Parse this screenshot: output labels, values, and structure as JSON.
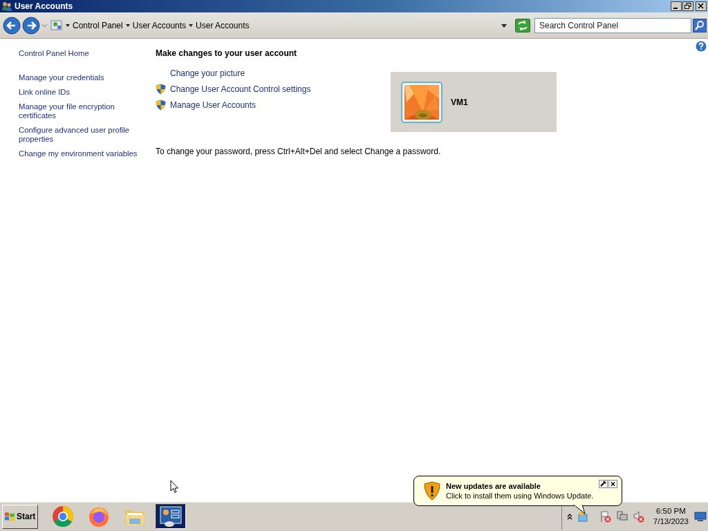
{
  "window": {
    "title": "User Accounts"
  },
  "address_bar": {
    "breadcrumb": [
      "Control Panel",
      "User Accounts",
      "User Accounts"
    ],
    "search": {
      "placeholder": "Search Control Panel"
    }
  },
  "sidebar": {
    "home": "Control Panel Home",
    "links": [
      "Manage your credentials",
      "Link online IDs",
      "Manage your file encryption certificates",
      "Configure advanced user profile properties",
      "Change my environment variables"
    ]
  },
  "main": {
    "heading": "Make changes to your user account",
    "tasks": [
      {
        "label": "Change your picture",
        "shield": false
      },
      {
        "label": "Change User Account Control settings",
        "shield": true
      },
      {
        "label": "Manage User Accounts",
        "shield": true
      }
    ],
    "note": "To change your password, press Ctrl+Alt+Del and select Change a password."
  },
  "account": {
    "name": "VM1"
  },
  "notification": {
    "title": "New updates are available",
    "message": "Click to install them using Windows Update."
  },
  "taskbar": {
    "start": "Start",
    "apps": [
      {
        "kind": "chrome",
        "selected": false
      },
      {
        "kind": "firefox",
        "selected": false
      },
      {
        "kind": "explorer",
        "selected": false
      },
      {
        "kind": "control-panel",
        "selected": true
      }
    ],
    "clock": {
      "time": "6:50 PM",
      "date": "7/13/2023"
    }
  }
}
